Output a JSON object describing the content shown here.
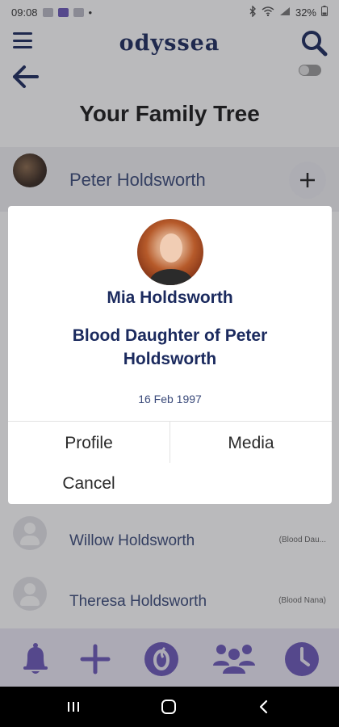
{
  "status_bar": {
    "time": "09:08",
    "battery": "32%"
  },
  "app": {
    "brand": "odyssea"
  },
  "page": {
    "title": "Your Family Tree"
  },
  "members": [
    {
      "name": "Peter Holdsworth",
      "relation": ""
    },
    {
      "name": "Willow Holdsworth",
      "relation": "(Blood Dau..."
    },
    {
      "name": "Theresa Holdsworth",
      "relation": "(Blood Nana)"
    }
  ],
  "dialog": {
    "name": "Mia Holdsworth",
    "relation": "Blood Daughter of Peter Holdsworth",
    "date": "16 Feb 1997",
    "profile_label": "Profile",
    "media_label": "Media",
    "cancel_label": "Cancel"
  },
  "colors": {
    "brand": "#1b2a5e",
    "nav_background": "#ebe8f5",
    "nav_icon": "#6a57b8"
  },
  "icons": {
    "menu": "hamburger-icon",
    "search": "search-icon",
    "back": "arrow-left-icon",
    "add_member": "plus-icon",
    "nav": [
      "bell-icon",
      "plus-icon",
      "odyssea-logo-icon",
      "family-icon",
      "clock-icon"
    ]
  }
}
